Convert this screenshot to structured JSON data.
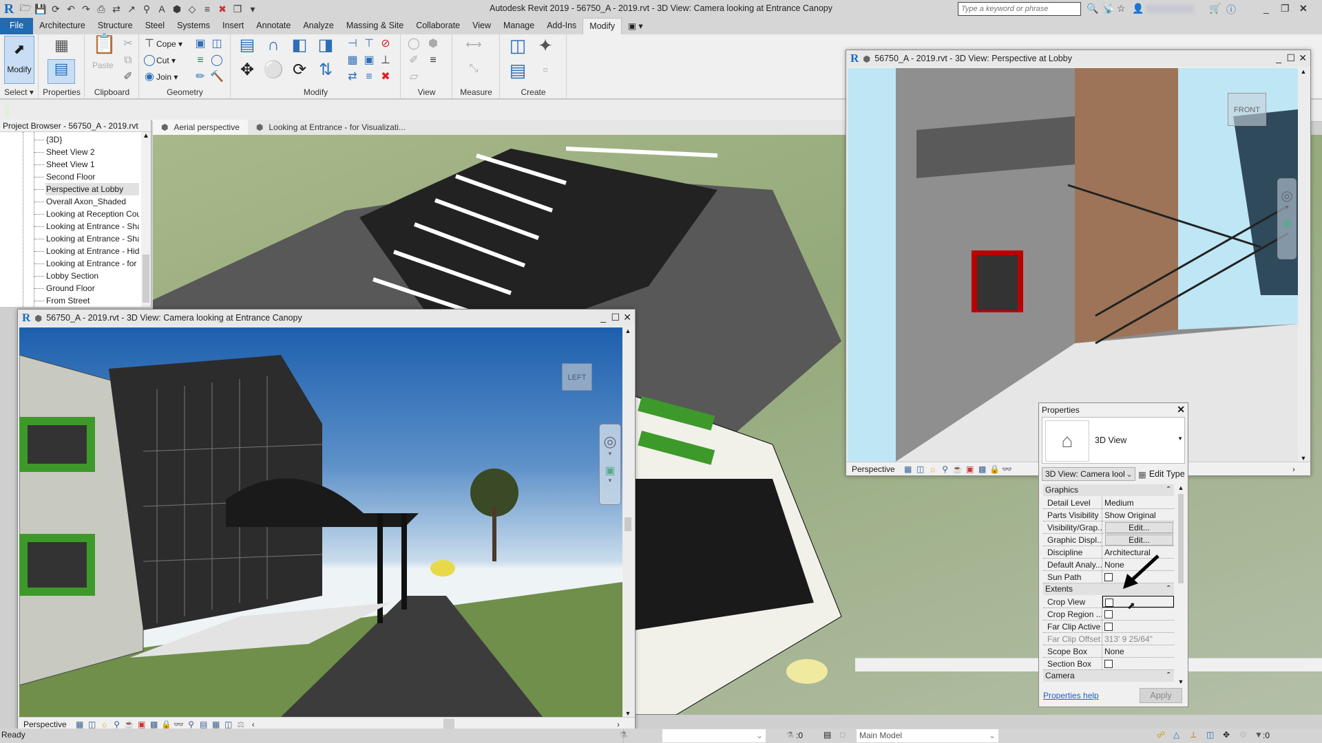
{
  "app": {
    "title": "Autodesk Revit 2019 - 56750_A - 2019.rvt - 3D View: Camera looking at Entrance Canopy",
    "search_placeholder": "Type a keyword or phrase"
  },
  "quick_access": [
    "open-icon",
    "save-icon",
    "sync-icon",
    "undo-icon",
    "redo-icon",
    "print-icon",
    "measure-icon",
    "dimension-icon",
    "tag-icon",
    "text-icon",
    "3d-view-icon",
    "section-icon",
    "thin-lines-icon",
    "close-hidden-icon",
    "switch-windows-icon",
    "customize-icon"
  ],
  "ribbon": {
    "tabs": [
      "File",
      "Architecture",
      "Structure",
      "Steel",
      "Systems",
      "Insert",
      "Annotate",
      "Analyze",
      "Massing & Site",
      "Collaborate",
      "View",
      "Manage",
      "Add-Ins",
      "Modify"
    ],
    "active_tab": "Modify",
    "panels": {
      "select": {
        "label": "Select",
        "modify_label": "Modify"
      },
      "properties": {
        "label": "Properties"
      },
      "clipboard": {
        "label": "Clipboard",
        "paste_label": "Paste"
      },
      "geometry": {
        "label": "Geometry",
        "cope_label": "Cope",
        "cut_label": "Cut",
        "join_label": "Join"
      },
      "modify": {
        "label": "Modify"
      },
      "view": {
        "label": "View"
      },
      "measure": {
        "label": "Measure"
      },
      "create": {
        "label": "Create"
      }
    }
  },
  "project_browser": {
    "title": "Project Browser - 56750_A - 2019.rvt",
    "items": [
      "{3D}",
      "Sheet View 2",
      "Sheet View 1",
      "Second Floor",
      "Perspective at Lobby",
      "Overall Axon_Shaded",
      "Looking at Reception Cou",
      "Looking at Entrance - Sha",
      "Looking at Entrance - Sha",
      "Looking at Entrance - Hid",
      "Looking at Entrance - for",
      "Lobby Section",
      "Ground Floor",
      "From Street"
    ],
    "selected_index": 4
  },
  "view_tabs": [
    {
      "label": "Aerial perspective",
      "active": true
    },
    {
      "label": "Looking at Entrance - for Visualizati...",
      "active": false
    }
  ],
  "windows": {
    "camera": {
      "title": "56750_A - 2019.rvt - 3D View: Camera looking at Entrance Canopy",
      "viewcube": "LEFT",
      "view_control": "Perspective"
    },
    "lobby": {
      "title": "56750_A - 2019.rvt - 3D View: Perspective at Lobby",
      "viewcube": "FRONT",
      "view_control": "Perspective"
    },
    "main": {
      "view_control": "Perspective"
    }
  },
  "properties": {
    "title": "Properties",
    "type_name": "3D View",
    "instance_selector": "3D View: Camera lool",
    "edit_type_label": "Edit Type",
    "groups": [
      {
        "name": "Graphics",
        "rows": [
          {
            "name": "Detail Level",
            "value": "Medium",
            "kind": "text"
          },
          {
            "name": "Parts Visibility",
            "value": "Show Original",
            "kind": "text"
          },
          {
            "name": "Visibility/Grap...",
            "value": "Edit...",
            "kind": "button"
          },
          {
            "name": "Graphic Displ...",
            "value": "Edit...",
            "kind": "button"
          },
          {
            "name": "Discipline",
            "value": "Architectural",
            "kind": "text"
          },
          {
            "name": "Default Analy...",
            "value": "None",
            "kind": "text"
          },
          {
            "name": "Sun Path",
            "value": false,
            "kind": "checkbox"
          }
        ]
      },
      {
        "name": "Extents",
        "rows": [
          {
            "name": "Crop View",
            "value": false,
            "kind": "checkbox"
          },
          {
            "name": "Crop Region ...",
            "value": false,
            "kind": "checkbox"
          },
          {
            "name": "Far Clip Active",
            "value": false,
            "kind": "checkbox"
          },
          {
            "name": "Far Clip Offset",
            "value": "313'  9 25/64\"",
            "kind": "readonly"
          },
          {
            "name": "Scope Box",
            "value": "None",
            "kind": "text"
          },
          {
            "name": "Section Box",
            "value": false,
            "kind": "checkbox"
          }
        ]
      },
      {
        "name": "Camera",
        "rows": []
      }
    ],
    "help_label": "Properties help",
    "apply_label": "Apply"
  },
  "status": {
    "text": "Ready",
    "worksets_count": ":0",
    "model": "Main Model",
    "filter_count": ":0"
  }
}
